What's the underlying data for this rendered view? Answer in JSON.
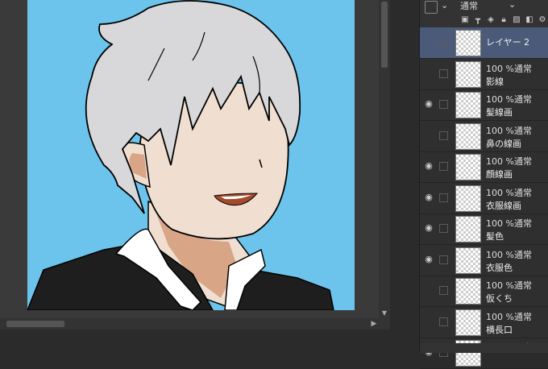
{
  "toolbar": {
    "blend_mode": "通常",
    "icons": [
      "layer-color-icon",
      "clip-icon",
      "reference-icon",
      "lock-icon",
      "lock-transparent-icon",
      "mask-icon"
    ]
  },
  "layers": [
    {
      "mode": "",
      "name": "レイヤー 2",
      "visible": false,
      "selected": true
    },
    {
      "mode": "100 %通常",
      "name": "影線",
      "visible": false
    },
    {
      "mode": "100 %通常",
      "name": "髪線画",
      "visible": true
    },
    {
      "mode": "100 %通常",
      "name": "鼻の線画",
      "visible": false
    },
    {
      "mode": "100 %通常",
      "name": "顔線画",
      "visible": true
    },
    {
      "mode": "100 %通常",
      "name": "衣服線画",
      "visible": true
    },
    {
      "mode": "100 %通常",
      "name": "髪色",
      "visible": true
    },
    {
      "mode": "100 %通常",
      "name": "衣服色",
      "visible": true
    },
    {
      "mode": "100 %通常",
      "name": "仮くち",
      "visible": false
    },
    {
      "mode": "100 %通常",
      "name": "横長口",
      "visible": false
    },
    {
      "mode": "100 %通常",
      "name": "",
      "visible": true
    }
  ],
  "colors": {
    "background": "#6cc4ec",
    "hair": "#d8d8da",
    "skin": "#f0dfd0",
    "shadow": "#d9a587",
    "clothing": "#1e1e1e",
    "collar": "#ffffff",
    "mouth": "#a44a2c",
    "selected_layer": "#4a5a78"
  }
}
